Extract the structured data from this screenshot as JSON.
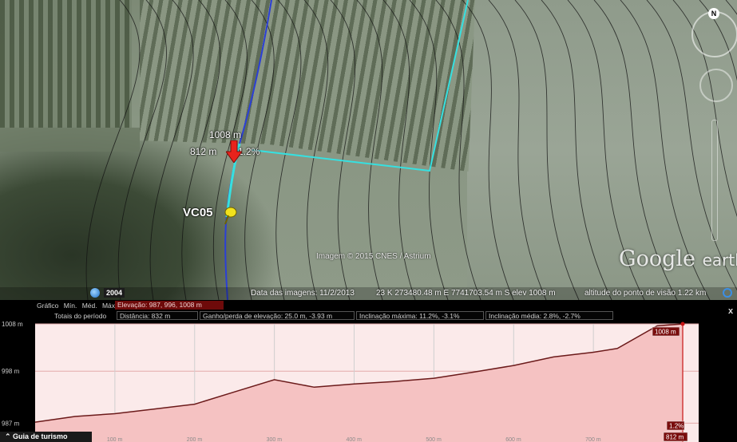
{
  "map": {
    "marker": {
      "elevation": "1008 m",
      "distance": "812 m",
      "slope": "1.2%"
    },
    "placemark": "VC05",
    "copyright": "Imagem © 2015 CNES / Astrium",
    "logo_main": "Google",
    "logo_sub": "earth",
    "north_label": "N",
    "historical_year": "2004",
    "status": {
      "date": "Data das imagens: 11/2/2013",
      "coords": "23 K 273480.48 m E 7741703.54 m S  elev  1008 m",
      "eye": "altitude do ponto de visão   1.22 km"
    },
    "colors": {
      "route": "#2b3fd6",
      "boundary": "#36e0e0",
      "marker": "#e8231c",
      "pin": "#f2e21c"
    }
  },
  "profile": {
    "header": {
      "graph_label": "Gráfico",
      "min": "Mín.",
      "avg": "Méd.",
      "max": "Máx",
      "elevation": "Elevação: 987, 996, 1008 m"
    },
    "totals": {
      "label": "Totais do período",
      "distance": "Distância: 832 m",
      "gain": "Ganho/perda de elevação: 25.0 m, -3.93 m",
      "max_slope": "Inclinação máxima: 11.2%, -3.1%",
      "avg_slope": "Inclinação média: 2.8%, -2.7%"
    },
    "close": "x",
    "cursor_elev_label": "1008 m",
    "cursor_slope_label": "1.2%",
    "cursor_dist_label": "812 m"
  },
  "chart_data": {
    "type": "area",
    "x": [
      0,
      50,
      100,
      150,
      200,
      250,
      300,
      350,
      400,
      450,
      500,
      550,
      600,
      650,
      700,
      730,
      780,
      812
    ],
    "values": [
      987.2,
      988.4,
      989.0,
      990.0,
      991.0,
      993.6,
      996.2,
      994.6,
      995.3,
      995.8,
      996.5,
      997.8,
      999.2,
      1001.0,
      1002.0,
      1002.8,
      1007.6,
      1008.0
    ],
    "xlim": [
      0,
      832
    ],
    "ylim": [
      983,
      1008
    ],
    "yticks": [
      987,
      998,
      1008
    ],
    "ytick_labels": [
      "987 m",
      "998 m",
      "1008 m"
    ],
    "xticks": [
      100,
      200,
      300,
      400,
      500,
      600,
      700
    ],
    "xtick_labels": [
      "100 m",
      "200 m",
      "300 m",
      "400 m",
      "500 m",
      "600 m",
      "700 m"
    ],
    "cursor_x": 812,
    "grid": true,
    "fill_color": "#f5c2c2",
    "line_color": "#6b1a1a"
  },
  "footer": {
    "guide": "Guia de turismo"
  }
}
